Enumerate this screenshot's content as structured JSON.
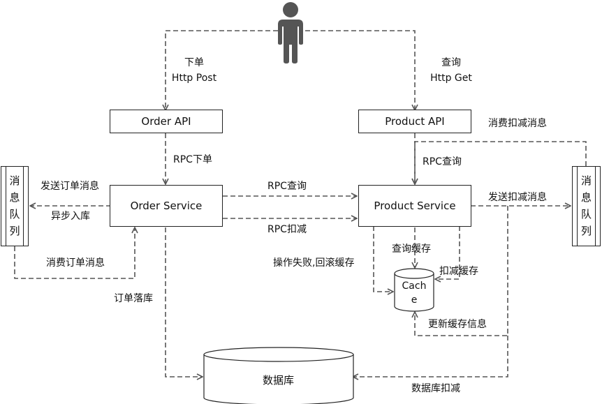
{
  "nodes": {
    "order_api": "Order API",
    "product_api": "Product API",
    "order_service": "Order Service",
    "product_service": "Product Service",
    "cache_line1": "Cach",
    "cache_line2": "e",
    "database": "数据库",
    "left_queue": [
      "消",
      "息",
      "队",
      "列"
    ],
    "right_queue": [
      "消",
      "息",
      "队",
      "列"
    ]
  },
  "labels": {
    "order_action": "下单",
    "order_method": "Http Post",
    "query_action": "查询",
    "query_method": "Http Get",
    "rpc_order": "RPC下单",
    "rpc_query_left": "RPC查询",
    "rpc_query_top": "RPC查询",
    "rpc_deduct": "RPC扣减",
    "send_order_msg": "发送订单消息",
    "async_store": "异步入库",
    "consume_order_msg": "消费订单消息",
    "order_persist": "订单落库",
    "consume_deduct_msg": "消费扣减消息",
    "send_deduct_msg": "发送扣减消息",
    "query_cache": "查询缓存",
    "deduct_cache": "扣减缓存",
    "rollback_cache": "操作失败,回滚缓存",
    "update_cache_info": "更新缓存信息",
    "db_deduct": "数据库扣减"
  },
  "colors": {
    "line": "#555555",
    "user": "#555555"
  }
}
